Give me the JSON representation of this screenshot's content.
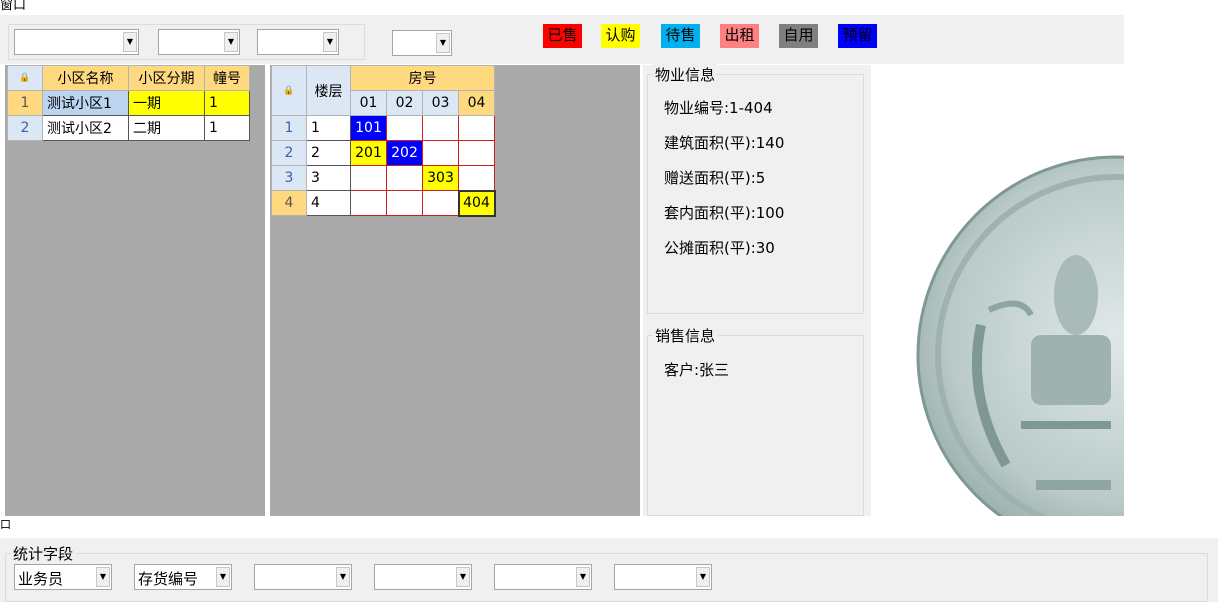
{
  "window": {
    "title_top": "窗口",
    "title_bottom": "口"
  },
  "filters": {
    "combo1": "",
    "combo2": "",
    "combo3": "",
    "combo4": ""
  },
  "legend": [
    {
      "label": "已售",
      "color": "#ff0000"
    },
    {
      "label": "认购",
      "color": "#ffff00"
    },
    {
      "label": "待售",
      "color": "#00b0f0"
    },
    {
      "label": "出租",
      "color": "#ff8080"
    },
    {
      "label": "自用",
      "color": "#808080"
    },
    {
      "label": "预留",
      "color": "#0000ff"
    }
  ],
  "community_table": {
    "headers": [
      "小区名称",
      "小区分期",
      "幢号"
    ],
    "rows": [
      {
        "num": "1",
        "name": "测试小区1",
        "phase": "一期",
        "building": "1"
      },
      {
        "num": "2",
        "name": "测试小区2",
        "phase": "二期",
        "building": "1"
      }
    ]
  },
  "room_grid": {
    "floor_header": "楼层",
    "room_header": "房号",
    "columns": [
      "01",
      "02",
      "03",
      "04"
    ],
    "rows": [
      {
        "num": "1",
        "floor": "1",
        "cells": [
          "101",
          "",
          "",
          ""
        ]
      },
      {
        "num": "2",
        "floor": "2",
        "cells": [
          "201",
          "202",
          "",
          ""
        ]
      },
      {
        "num": "3",
        "floor": "3",
        "cells": [
          "",
          "",
          "303",
          ""
        ]
      },
      {
        "num": "4",
        "floor": "4",
        "cells": [
          "",
          "",
          "",
          "404"
        ]
      }
    ],
    "cell_colors": {
      "101": "#0000ff",
      "201": "#ffff00",
      "202": "#0000ff",
      "303": "#ffff00",
      "404": "#ffff00"
    }
  },
  "property_info": {
    "title": "物业信息",
    "code": "物业编号:1-404",
    "build_area": "建筑面积(平):140",
    "gift_area": "赠送面积(平):5",
    "inner_area": "套内面积(平):100",
    "public_area": "公摊面积(平):30"
  },
  "sales_info": {
    "title": "销售信息",
    "customer": "客户:张三"
  },
  "stats": {
    "title": "统计字段",
    "fields": [
      "业务员",
      "存货编号",
      "",
      "",
      "",
      ""
    ]
  }
}
